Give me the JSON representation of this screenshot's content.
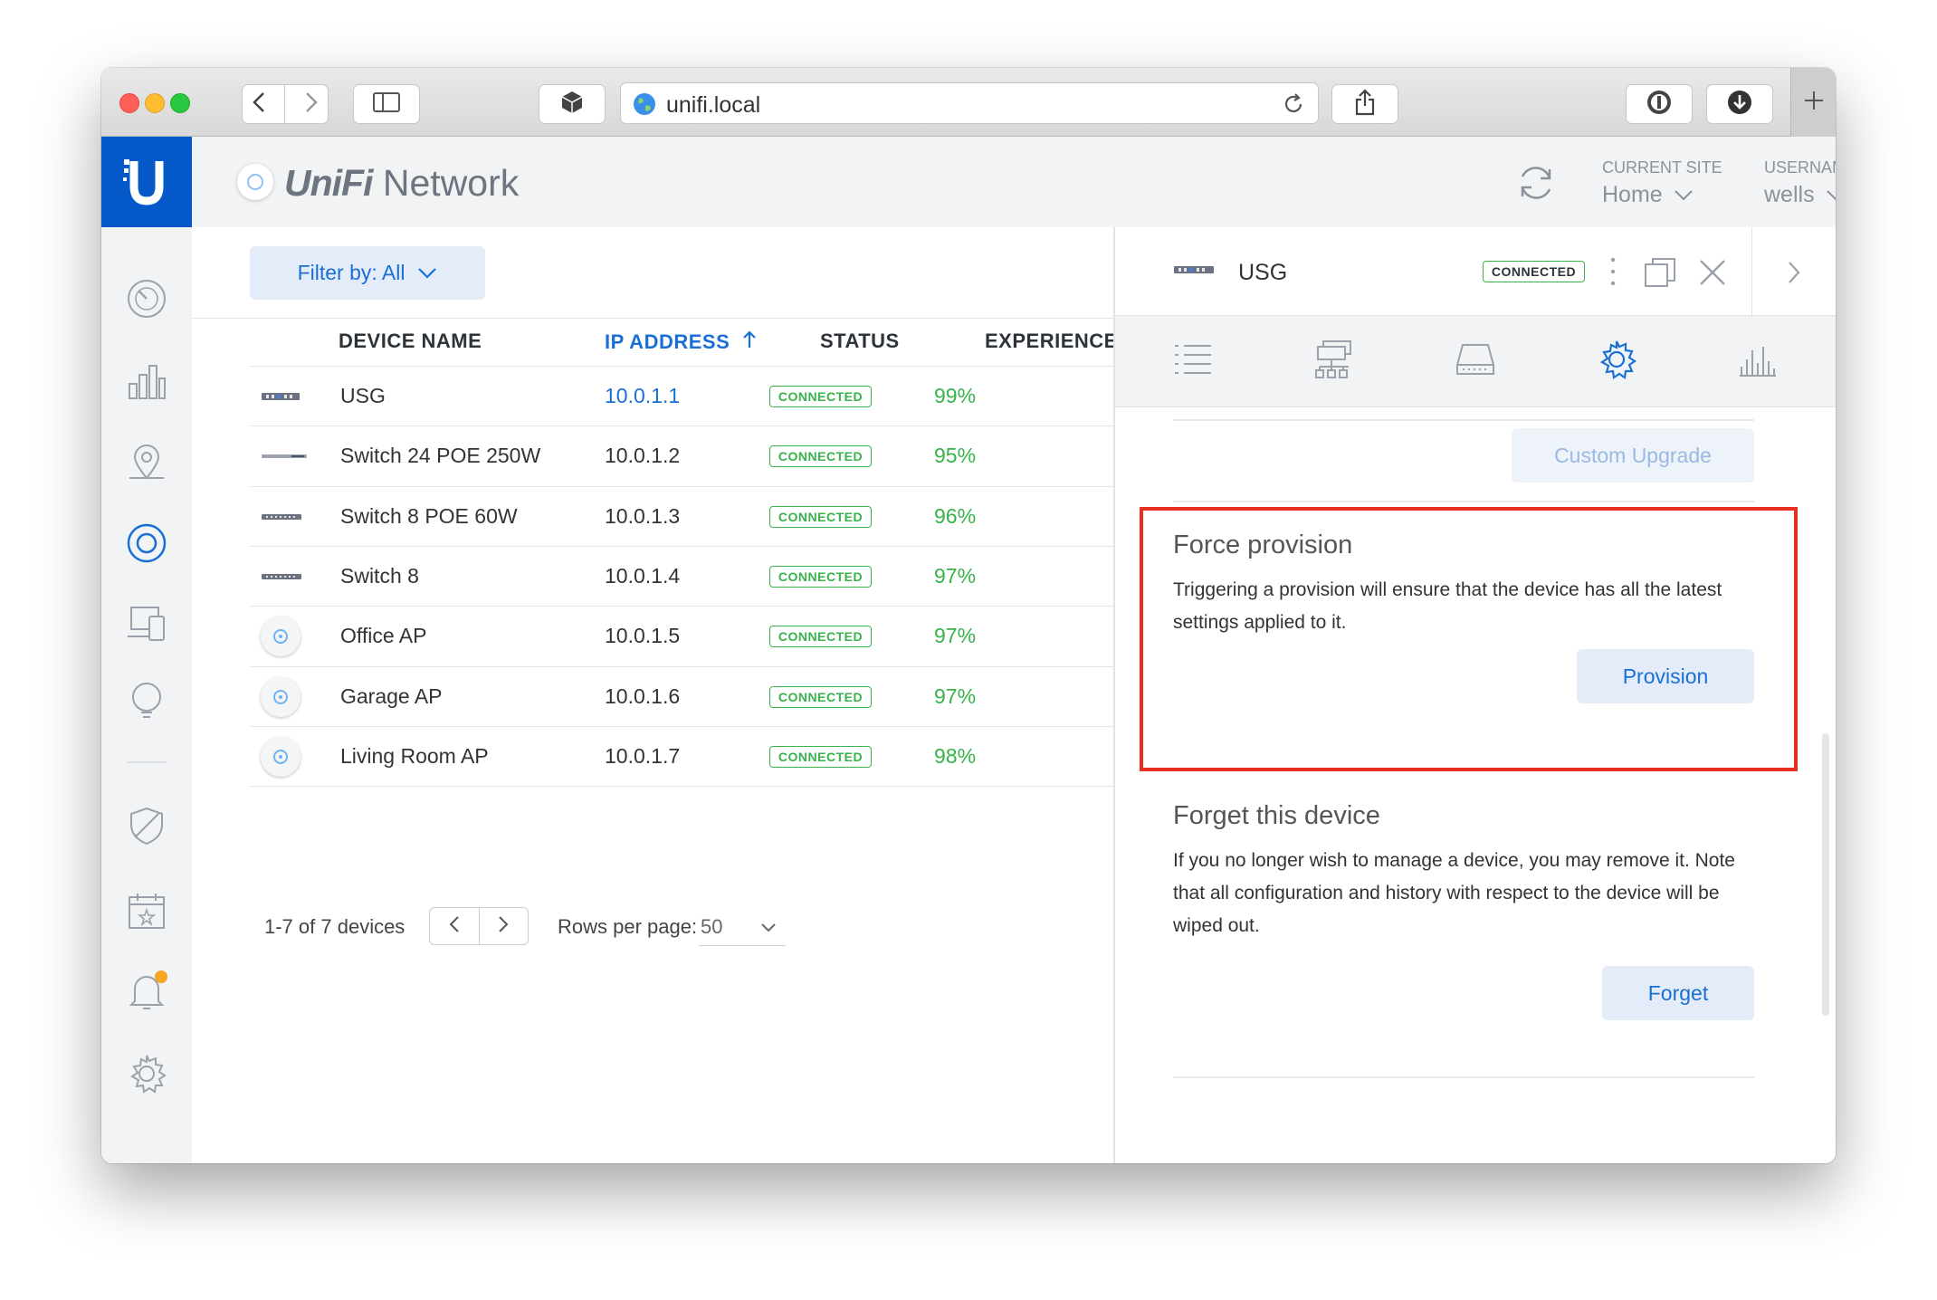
{
  "browser": {
    "url": "unifi.local",
    "controls": [
      "back",
      "forward",
      "sidebar",
      "package",
      "share",
      "onepassword",
      "download",
      "new-tab"
    ]
  },
  "app": {
    "brand_prefix": "UniFi",
    "brand_suffix": "Network",
    "refresh_icon": "refresh-icon",
    "current_site_label": "CURRENT SITE",
    "current_site_value": "Home",
    "username_label": "USERNAME",
    "username_value": "wells"
  },
  "sidebar": {
    "items": [
      "dashboard-icon",
      "statistics-icon",
      "map-icon",
      "devices-icon",
      "clients-icon",
      "insights-icon",
      "security-icon",
      "events-icon",
      "alerts-icon",
      "settings-icon"
    ],
    "active": "devices-icon",
    "alert_dot_color": "#f5a623"
  },
  "toolbar": {
    "filter_label": "Filter by: All"
  },
  "table": {
    "columns": {
      "device": "DEVICE NAME",
      "ip": "IP ADDRESS",
      "status": "STATUS",
      "experience": "EXPERIENCE"
    },
    "sort_column": "IP ADDRESS",
    "sort_direction": "ascending",
    "rows": [
      {
        "name": "USG",
        "ip": "10.0.1.1",
        "status": "CONNECTED",
        "experience": "99%",
        "type": "gateway",
        "ip_link": true
      },
      {
        "name": "Switch 24 POE 250W",
        "ip": "10.0.1.2",
        "status": "CONNECTED",
        "experience": "95%",
        "type": "switch24"
      },
      {
        "name": "Switch 8 POE 60W",
        "ip": "10.0.1.3",
        "status": "CONNECTED",
        "experience": "96%",
        "type": "switch8"
      },
      {
        "name": "Switch 8",
        "ip": "10.0.1.4",
        "status": "CONNECTED",
        "experience": "97%",
        "type": "switch8"
      },
      {
        "name": "Office AP",
        "ip": "10.0.1.5",
        "status": "CONNECTED",
        "experience": "97%",
        "type": "ap"
      },
      {
        "name": "Garage AP",
        "ip": "10.0.1.6",
        "status": "CONNECTED",
        "experience": "97%",
        "type": "ap"
      },
      {
        "name": "Living Room AP",
        "ip": "10.0.1.7",
        "status": "CONNECTED",
        "experience": "98%",
        "type": "ap"
      }
    ]
  },
  "pagination": {
    "summary": "1-7 of 7 devices",
    "rows_per_page_label": "Rows per page:",
    "rows_per_page_value": "50"
  },
  "panel": {
    "device_name": "USG",
    "status_badge": "CONNECTED",
    "tabs": [
      "details-icon",
      "network-icon",
      "ports-icon",
      "config-icon",
      "stats-icon"
    ],
    "active_tab": "config-icon",
    "custom_upgrade_label": "Custom Upgrade",
    "force_provision": {
      "title": "Force provision",
      "description": "Triggering a provision will ensure that the device has all the latest settings applied to it.",
      "button": "Provision"
    },
    "forget": {
      "title": "Forget this device",
      "description": "If you no longer wish to manage a device, you may remove it. Note that all configuration and history with respect to the device will be wiped out.",
      "button": "Forget"
    },
    "highlight_color": "#e8301f"
  },
  "colors": {
    "accent": "#1a6fd6",
    "brand_blue": "#0559c9",
    "success": "#37b34a"
  }
}
